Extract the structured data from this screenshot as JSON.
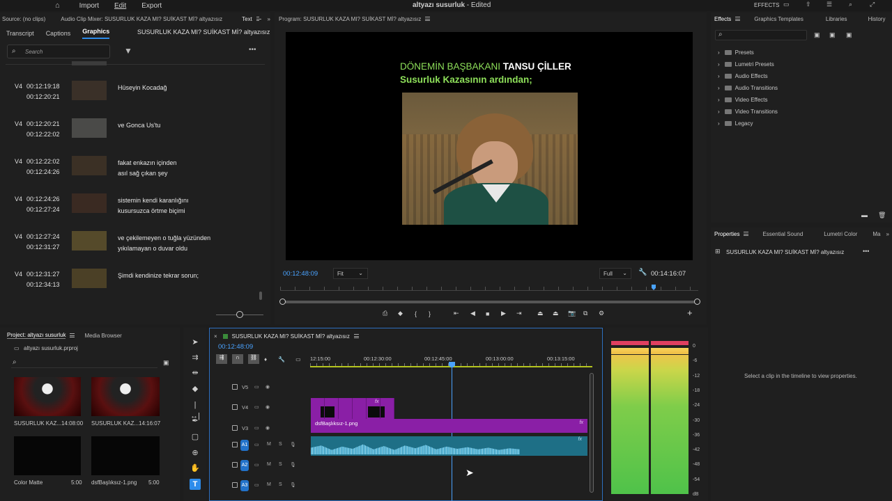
{
  "menubar": {
    "items": [
      "Import",
      "Edit",
      "Export"
    ],
    "title": "altyazı susurluk",
    "edited": " - Edited",
    "effects_label": "EFFECTS"
  },
  "source_panel": {
    "source_label": "Source: (no clips)",
    "mixer_label": "Audio Clip Mixer: SUSURLUK KAZA MI? SUİKAST Mİ? altyazısız",
    "text_label": "Text",
    "tabs": [
      "Transcript",
      "Captions",
      "Graphics"
    ],
    "active_tab": "Graphics",
    "sequence_name": "SUSURLUK KAZA MI? SUİKAST Mİ? altyazısız",
    "search_placeholder": "Search",
    "captions": [
      {
        "track": "V4",
        "in": "00:12:19:18",
        "out": "00:12:20:21",
        "line1": "Hüseyin Kocadağ",
        "line2": ""
      },
      {
        "track": "V4",
        "in": "00:12:20:21",
        "out": "00:12:22:02",
        "line1": "ve Gonca Us'tu",
        "line2": ""
      },
      {
        "track": "V4",
        "in": "00:12:22:02",
        "out": "00:12:24:26",
        "line1": "fakat enkazın içinden",
        "line2": "asıl sağ çıkan şey"
      },
      {
        "track": "V4",
        "in": "00:12:24:26",
        "out": "00:12:27:24",
        "line1": "sistemin kendi karanlığını",
        "line2": "kusursuzca örtme biçimi"
      },
      {
        "track": "V4",
        "in": "00:12:27:24",
        "out": "00:12:31:27",
        "line1": "ve çekilemeyen o tuğla yüzünden",
        "line2": "yıkılamayan o duvar oldu"
      },
      {
        "track": "V4",
        "in": "00:12:31:27",
        "out": "00:12:34:13",
        "line1": "Şimdi kendinize tekrar sorun;",
        "line2": ""
      }
    ]
  },
  "program": {
    "title": "Program: SUSURLUK KAZA MI? SUİKAST Mİ? altyazısız",
    "overlay_line1_a": "DÖNEMİN BAŞBAKANI ",
    "overlay_line1_b": "TANSU ÇİLLER",
    "overlay_line2": "Susurluk Kazasının ardından;",
    "timecode": "00:12:48:09",
    "fit": "Fit",
    "quality": "Full",
    "duration": "00:14:16:07"
  },
  "effects_panel": {
    "tabs": [
      "Effects",
      "Graphics Templates",
      "Libraries",
      "History"
    ],
    "items": [
      "Presets",
      "Lumetri Presets",
      "Audio Effects",
      "Audio Transitions",
      "Video Effects",
      "Video Transitions",
      "Legacy"
    ]
  },
  "properties_panel": {
    "tabs": [
      "Properties",
      "Essential Sound",
      "Lumetri Color",
      "Ma"
    ],
    "sequence_name": "SUSURLUK KAZA MI? SUİKAST Mİ? altyazısız",
    "empty_message": "Select a clip in the timeline to view properties."
  },
  "project_panel": {
    "tabs": [
      "Project: altyazı susurluk",
      "Media Browser"
    ],
    "file": "altyazı susurluk.prproj",
    "items": [
      {
        "name": "SUSURLUK KAZ...",
        "duration": "14:08:00"
      },
      {
        "name": "SUSURLUK KAZ...",
        "duration": "14:16:07"
      },
      {
        "name": "Color Matte",
        "duration": "5:00"
      },
      {
        "name": "dsfBaşlıksız-1.png",
        "duration": "5:00"
      }
    ]
  },
  "timeline": {
    "sequence_name": "SUSURLUK KAZA MI? SUİKAST Mİ? altyazısız",
    "timecode": "00:12:48:09",
    "ruler": [
      "12:15:00",
      "00:12:30:00",
      "00:12:45:00",
      "00:13:00:00",
      "00:13:15:00"
    ],
    "tracks": [
      "V5",
      "V4",
      "V3",
      "A1",
      "A2",
      "A3"
    ],
    "clip_label": "dsfBaşlıksız-1.png",
    "fx": "fx"
  },
  "meter": {
    "labels": [
      "0",
      "-6",
      "-12",
      "-18",
      "-24",
      "-30",
      "-36",
      "-42",
      "-48",
      "-54",
      "dB"
    ]
  },
  "colors": {
    "accent": "#2d8ceb",
    "clip_purple": "#8a1fa6",
    "audio_teal": "#1e6f86",
    "timecode_blue": "#4aa3ff"
  }
}
